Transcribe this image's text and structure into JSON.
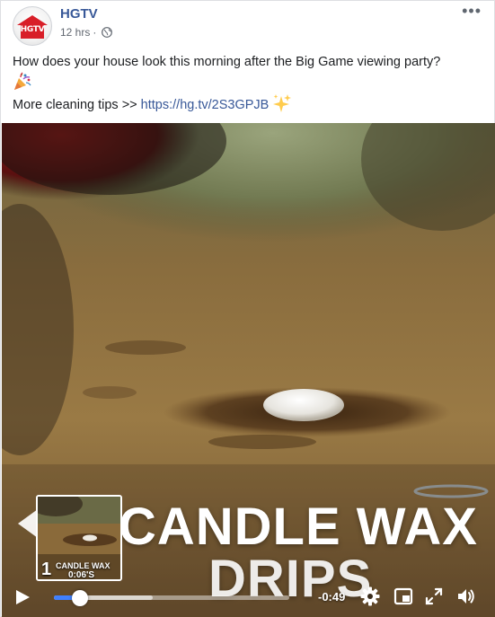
{
  "header": {
    "page_name": "HGTV",
    "avatar_logo_text": "HGTV",
    "timestamp": "12 hrs",
    "separator": "·",
    "privacy_icon": "globe-icon",
    "more_icon": "more-options-icon"
  },
  "post": {
    "line1": "How does your house look this morning after the Big Game viewing party?",
    "line1_emoji": "party-popper",
    "line2_prefix": "More cleaning tips >> ",
    "link_text": "https://hg.tv/2S3GPJB",
    "line2_emoji": "sparkles"
  },
  "video": {
    "caption_line1": "CANDLE WAX",
    "caption_line2": "DRIPS",
    "thumbnail": {
      "number": "1",
      "title": "CANDLE WAX",
      "time": "0:06'S"
    },
    "controls": {
      "time_remaining": "-0:49",
      "progress_fraction": 0.11,
      "buffered_fraction": 0.42,
      "icons": [
        "play-icon",
        "settings-icon",
        "picture-in-picture-icon",
        "fullscreen-icon",
        "volume-icon"
      ]
    }
  },
  "colors": {
    "link": "#385898",
    "page_name": "#385898",
    "scrubber": "#4080ff",
    "brand_red": "#d81e28"
  }
}
